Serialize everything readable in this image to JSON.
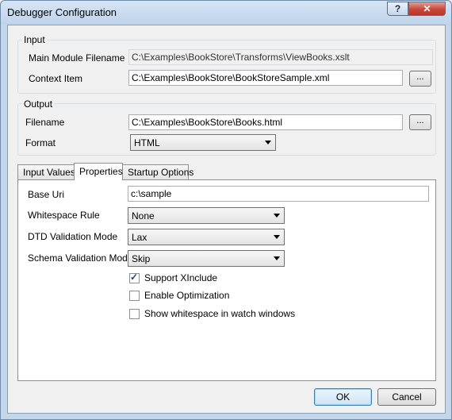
{
  "window": {
    "title": "Debugger Configuration",
    "help_glyph": "?",
    "close_glyph": "✕"
  },
  "input_group": {
    "label": "Input",
    "main_module_label": "Main Module Filename",
    "main_module_value": "C:\\Examples\\BookStore\\Transforms\\ViewBooks.xslt",
    "context_item_label": "Context Item",
    "context_item_value": "C:\\Examples\\BookStore\\BookStoreSample.xml",
    "browse_label": "..."
  },
  "output_group": {
    "label": "Output",
    "filename_label": "Filename",
    "filename_value": "C:\\Examples\\BookStore\\Books.html",
    "browse_label": "...",
    "format_label": "Format",
    "format_value": "HTML"
  },
  "tabs": [
    {
      "label": "Input Values"
    },
    {
      "label": "Properties"
    },
    {
      "label": "Startup Options"
    }
  ],
  "properties": {
    "base_uri_label": "Base Uri",
    "base_uri_value": "c:\\sample",
    "whitespace_label": "Whitespace Rule",
    "whitespace_value": "None",
    "dtd_label": "DTD Validation Mode",
    "dtd_value": "Lax",
    "schema_label": "Schema Validation Mode",
    "schema_value": "Skip",
    "checkboxes": [
      {
        "label": "Support XInclude",
        "checked": true
      },
      {
        "label": "Enable Optimization",
        "checked": false
      },
      {
        "label": "Show whitespace in watch windows",
        "checked": false
      }
    ]
  },
  "buttons": {
    "ok": "OK",
    "cancel": "Cancel"
  }
}
